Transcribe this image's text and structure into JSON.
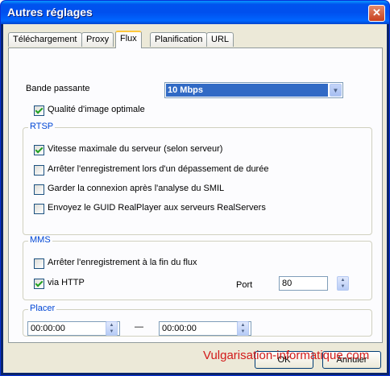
{
  "window": {
    "title": "Autres réglages",
    "close_symbol": "✕"
  },
  "tabs": [
    {
      "label": "Téléchargement"
    },
    {
      "label": "Proxy"
    },
    {
      "label": "Flux"
    },
    {
      "label": "Planification"
    },
    {
      "label": "URL"
    }
  ],
  "active_tab": "Flux",
  "bandwidth": {
    "label": "Bande passante",
    "selected": "10 Mbps"
  },
  "image_quality": {
    "label": "Qualité d'image optimale",
    "checked": true
  },
  "rtsp": {
    "title": "RTSP",
    "options": [
      {
        "label": "Vitesse maximale du serveur (selon serveur)",
        "checked": true
      },
      {
        "label": "Arrêter l'enregistrement lors d'un dépassement de durée",
        "checked": false
      },
      {
        "label": "Garder la connexion après l'analyse du SMIL",
        "checked": false
      },
      {
        "label": "Envoyez le GUID RealPlayer aux serveurs RealServers",
        "checked": false
      }
    ]
  },
  "mms": {
    "title": "MMS",
    "stop_at_end": {
      "label": "Arrêter l'enregistrement à la fin du flux",
      "checked": false
    },
    "via_http": {
      "label": "via HTTP",
      "checked": true
    },
    "port_label": "Port",
    "port_value": "80"
  },
  "placer": {
    "title": "Placer",
    "start": "00:00:00",
    "separator": "—",
    "end": "00:00:00"
  },
  "buttons": {
    "ok": "OK",
    "cancel": "Annuler"
  },
  "watermark": "Vulgarisation-informatique.com",
  "colors": {
    "titlebar": "#0054e3",
    "legend": "#0046d5",
    "selection": "#316ac5",
    "watermark": "#d21a1a"
  }
}
